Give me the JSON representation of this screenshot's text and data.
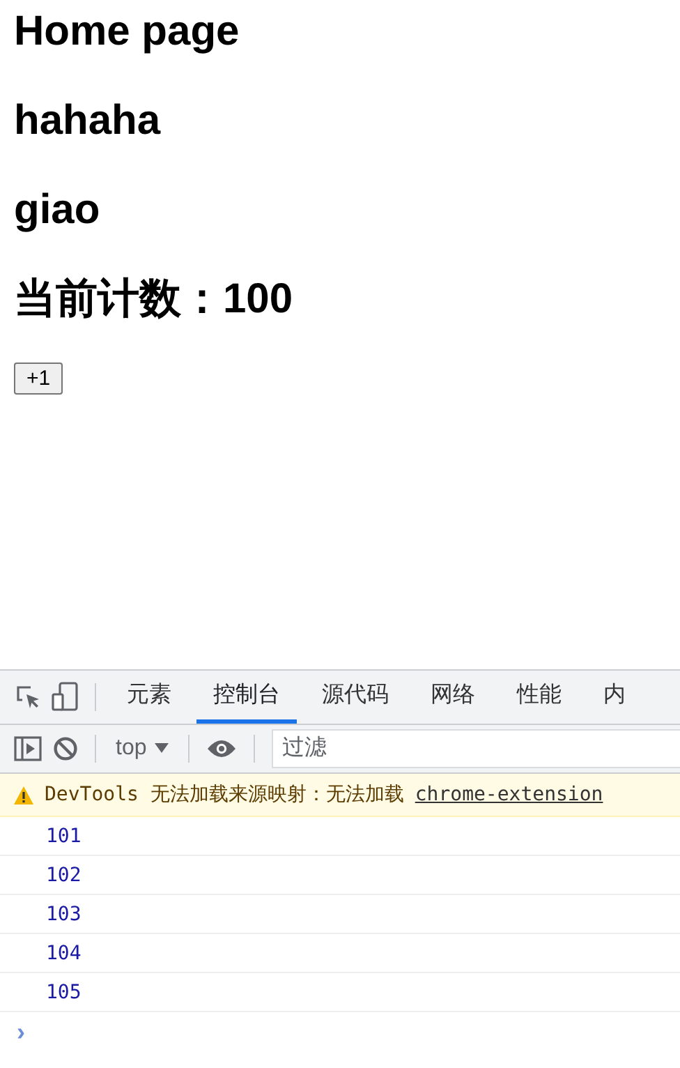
{
  "page": {
    "title": "Home page",
    "headings": [
      "hahaha",
      "giao",
      "当前计数：100"
    ],
    "button": "+1"
  },
  "devtools": {
    "tabs": [
      {
        "label": "元素",
        "selected": false
      },
      {
        "label": "控制台",
        "selected": true
      },
      {
        "label": "源代码",
        "selected": false
      },
      {
        "label": "网络",
        "selected": false
      },
      {
        "label": "性能",
        "selected": false
      },
      {
        "label": "内",
        "selected": false
      }
    ],
    "context": "top",
    "filter": {
      "placeholder": "过滤"
    },
    "warning": {
      "text": "DevTools 无法加载来源映射：无法加载",
      "link": "chrome-extension"
    },
    "logs": [
      "101",
      "102",
      "103",
      "104",
      "105"
    ],
    "prompt": "›"
  }
}
